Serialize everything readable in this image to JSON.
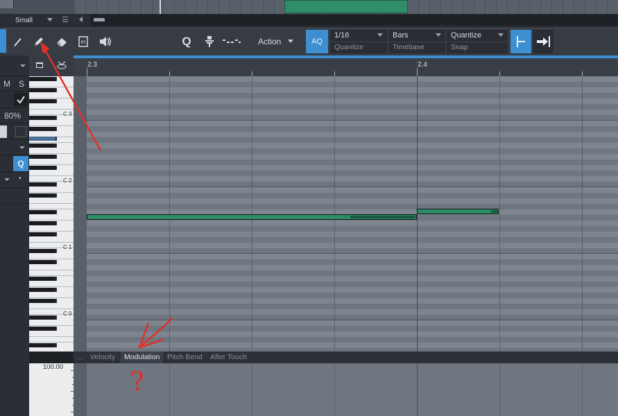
{
  "window": {
    "layout_size": "Small"
  },
  "toolbar": {
    "tools": [
      {
        "name": "arrow-tool",
        "glyph": "✎"
      },
      {
        "name": "pencil-tool",
        "glyph": "✏"
      },
      {
        "name": "eraser-tool",
        "glyph": "⌫"
      },
      {
        "name": "mute-tool",
        "glyph": "▣"
      },
      {
        "name": "listen-tool",
        "glyph": "🔊"
      }
    ],
    "quantize_icon": "Q",
    "action_label": "Action",
    "aq_label": "AQ",
    "quantize_value": "1/16",
    "quantize_caption": "Quantize",
    "timebase_value": "Bars",
    "timebase_caption": "Timebase",
    "snap_value": "Quantize",
    "snap_caption": "Snap"
  },
  "left_panel": {
    "mute_label": "M",
    "solo_label": "S",
    "zoom_value": "80%",
    "q_label": "Q",
    "dot_label": "•"
  },
  "ruler": {
    "positions": [
      "2.3",
      "2.4"
    ]
  },
  "keyboard": {
    "octaves": [
      "C 3",
      "C 2",
      "C 1",
      "C 0"
    ]
  },
  "lanes": {
    "more": "...",
    "tabs": [
      "Velocity",
      "Modulation",
      "Pitch Bend",
      "After Touch"
    ],
    "active_tab": "Modulation",
    "max_value": "100.00"
  },
  "annotation": {
    "question_mark": "?",
    "color": "#e0302a"
  },
  "colors": {
    "accent": "#3e8fd2",
    "note": "#2e8c68",
    "note_velocity": "#1c5a43"
  }
}
